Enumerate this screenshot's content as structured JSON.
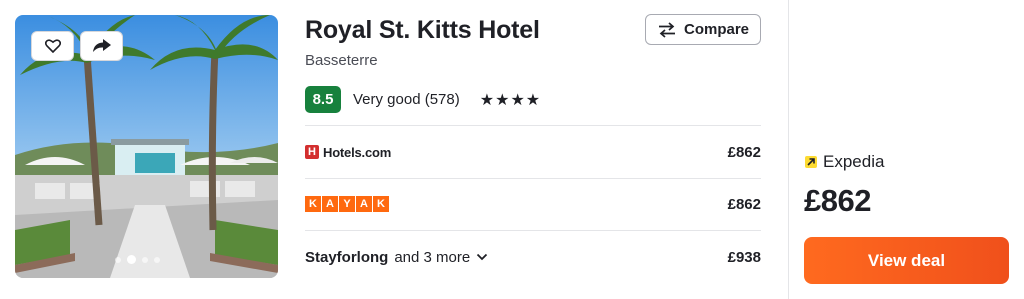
{
  "hotel": {
    "name": "Royal St. Kitts Hotel",
    "location": "Basseterre",
    "score": "8.5",
    "score_label": "Very good (578)",
    "stars": "★★★★"
  },
  "compare": {
    "label": "Compare"
  },
  "photo": {
    "icons": [
      "heart-icon",
      "share-icon"
    ],
    "carousel_dots": 4,
    "active_dot": 1
  },
  "offers": [
    {
      "provider": "Hotels.com",
      "price": "£862"
    },
    {
      "provider": "KAYAK",
      "price": "£862",
      "logo_letters": [
        "K",
        "A",
        "Y",
        "A",
        "K"
      ]
    },
    {
      "provider": "Stayforlong",
      "more": "and 3 more",
      "price": "£938"
    }
  ],
  "deal": {
    "provider": "Expedia",
    "price": "£862",
    "button_label": "View deal"
  },
  "colors": {
    "score_bg": "#17813d",
    "deal_button": "#ff6a1f",
    "kayak": "#ff690f",
    "hotels": "#d32f2f",
    "expedia": "#fddb32"
  }
}
